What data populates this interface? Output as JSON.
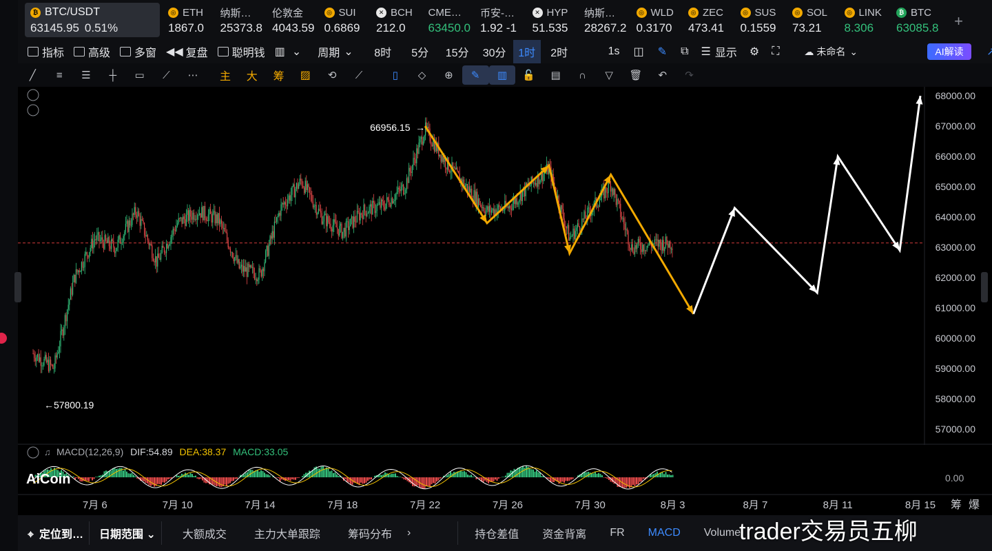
{
  "tickers": [
    {
      "symbol": "BTC/USDT",
      "price": "63145.95",
      "change": "0.51%",
      "icon": "bitcoin-icon",
      "active": true
    },
    {
      "symbol": "ETH",
      "price": "1867.0",
      "icon": "coin-icon"
    },
    {
      "symbol": "纳斯…",
      "price": "25373.8"
    },
    {
      "symbol": "伦敦金",
      "price": "4043.59"
    },
    {
      "symbol": "SUI",
      "price": "0.6869",
      "icon": "coin-icon"
    },
    {
      "symbol": "BCH",
      "price": "212.0",
      "icon": "bch-icon"
    },
    {
      "symbol": "CME…",
      "price": "63450.0",
      "up": true
    },
    {
      "symbol": "币安-…",
      "price": "1.92 -1"
    },
    {
      "symbol": "HYP",
      "price": "51.535",
      "icon": "hyp-icon"
    },
    {
      "symbol": "纳斯…",
      "price": "28267.2"
    },
    {
      "symbol": "WLD",
      "price": "0.3170",
      "icon": "coin-icon"
    },
    {
      "symbol": "ZEC",
      "price": "473.41",
      "icon": "coin-icon"
    },
    {
      "symbol": "SUS",
      "price": "0.1559",
      "icon": "coin-icon"
    },
    {
      "symbol": "SOL",
      "price": "73.21",
      "icon": "coin-icon"
    },
    {
      "symbol": "LINK",
      "price": "8.306",
      "icon": "coin-icon",
      "up": true
    },
    {
      "symbol": "BTC",
      "price": "63085.8",
      "icon": "bitcoin-icon",
      "up": true
    }
  ],
  "toolbar": {
    "indicators": "指标",
    "advanced": "高级",
    "multi_window": "多窗",
    "replay": "复盘",
    "smart_money": "聪明钱",
    "period": "周期",
    "intervals": [
      "8时",
      "5分",
      "15分",
      "30分",
      "1时",
      "2时"
    ],
    "selected_interval": "1时",
    "seconds": "1s",
    "display": "显示",
    "unnamed": "未命名",
    "ai_read": "AI解读"
  },
  "draw_tools": {
    "main": "主",
    "large": "大",
    "chips": "筹"
  },
  "chart_data": {
    "type": "candlestick",
    "symbol": "BTC/USDT",
    "interval": "1时",
    "y_ticks": [
      68000,
      67000,
      66000,
      65000,
      64000,
      63000,
      62000,
      61000,
      60000,
      59000,
      58000,
      57000
    ],
    "ylim": [
      56500,
      68300
    ],
    "x_ticks": [
      "7月 6",
      "7月 10",
      "7月 14",
      "7月 18",
      "7月 22",
      "7月 26",
      "7月 30",
      "8月 3",
      "8月 7",
      "8月 11",
      "8月 15"
    ],
    "high_label": "66956.15",
    "low_label": "57800.19",
    "current_price": 63145.95,
    "price_path": [
      {
        "date": "7月 3",
        "price": 59500
      },
      {
        "date": "7月 4",
        "price": 59000
      },
      {
        "date": "7月 5",
        "price": 62000
      },
      {
        "date": "7月 6",
        "price": 63300
      },
      {
        "date": "7月 7",
        "price": 63000
      },
      {
        "date": "7月 8",
        "price": 64200
      },
      {
        "date": "7月 9",
        "price": 62500
      },
      {
        "date": "7月 10",
        "price": 63800
      },
      {
        "date": "7月 11",
        "price": 64200
      },
      {
        "date": "7月 12",
        "price": 63900
      },
      {
        "date": "7月 13",
        "price": 62300
      },
      {
        "date": "7月 14",
        "price": 62100
      },
      {
        "date": "7月 15",
        "price": 64300
      },
      {
        "date": "7月 16",
        "price": 65200
      },
      {
        "date": "7月 17",
        "price": 64000
      },
      {
        "date": "7月 18",
        "price": 63500
      },
      {
        "date": "7月 19",
        "price": 64200
      },
      {
        "date": "7月 20",
        "price": 64400
      },
      {
        "date": "7月 21",
        "price": 65000
      },
      {
        "date": "7月 22",
        "price": 66900
      },
      {
        "date": "7月 23",
        "price": 65800
      },
      {
        "date": "7月 24",
        "price": 65000
      },
      {
        "date": "7月 25",
        "price": 64200
      },
      {
        "date": "7月 26",
        "price": 64300
      },
      {
        "date": "7月 27",
        "price": 65000
      },
      {
        "date": "7月 28",
        "price": 65600
      },
      {
        "date": "7月 29",
        "price": 63300
      },
      {
        "date": "7月 30",
        "price": 64200
      },
      {
        "date": "7月 31",
        "price": 65100
      },
      {
        "date": "8月 1",
        "price": 63000
      },
      {
        "date": "8月 2",
        "price": 63100
      },
      {
        "date": "8月 3",
        "price": 63145
      }
    ],
    "yellow_waves": [
      {
        "date": "7月 22",
        "price": 67000
      },
      {
        "date": "7月 25",
        "price": 63800
      },
      {
        "date": "7月 28",
        "price": 65700
      },
      {
        "date": "7月 29",
        "price": 62800
      },
      {
        "date": "7月 31",
        "price": 65400
      },
      {
        "date": "8月 4",
        "price": 60800
      }
    ],
    "white_projection": [
      {
        "date": "8月 4",
        "price": 60800
      },
      {
        "date": "8月 6",
        "price": 64300
      },
      {
        "date": "8月 10",
        "price": 61500
      },
      {
        "date": "8月 11",
        "price": 66000
      },
      {
        "date": "8月 14",
        "price": 62900
      },
      {
        "date": "8月 15",
        "price": 68000
      }
    ],
    "macd": {
      "label": "MACD(12,26,9)",
      "dif": "DIF:54.89",
      "dea": "DEA:38.37",
      "macd": "MACD:33.05",
      "zero_tick": "0.00"
    }
  },
  "colors": {
    "up": "#33c07b",
    "down": "#e74a4a",
    "wave": "#f2a900",
    "projection": "#ffffff",
    "accent": "#3d8bff"
  },
  "logo": "AiCoin",
  "bottom_bar": {
    "locate": "定位到…",
    "date_range": "日期范围",
    "tabs": [
      "大额成交",
      "主力大单跟踪",
      "筹码分布"
    ],
    "right_tabs": [
      "持仓差值",
      "资金背离",
      "FR",
      "MACD",
      "Volume"
    ],
    "selected_tab": "MACD"
  },
  "right_corner": {
    "chips": "筹",
    "liq": "爆"
  },
  "watermark": "trader交易员五柳"
}
